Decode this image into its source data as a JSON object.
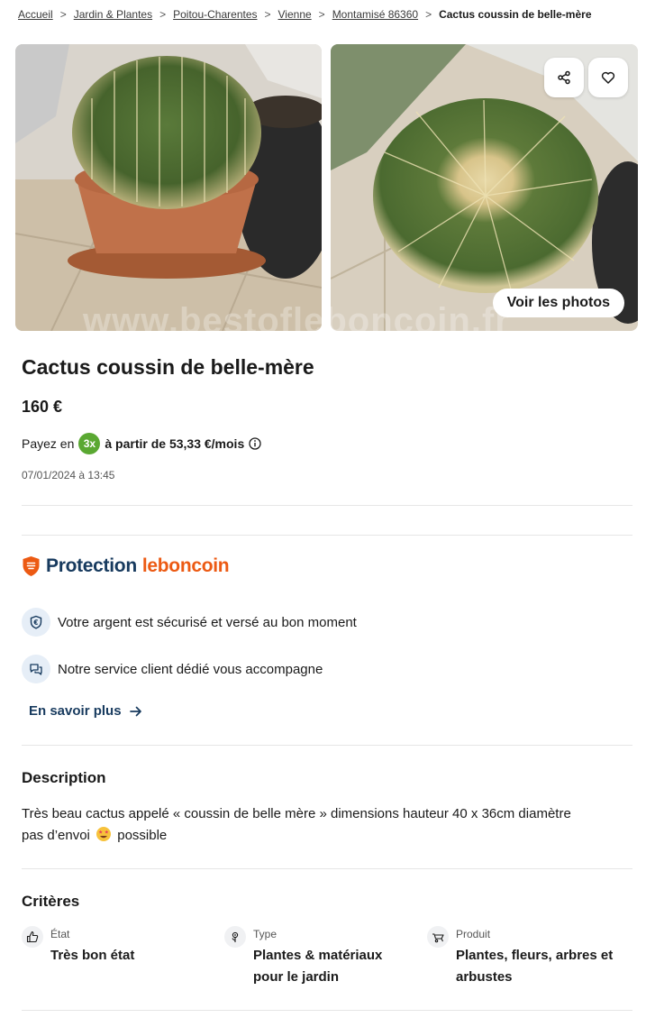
{
  "breadcrumb": {
    "items": [
      "Accueil",
      "Jardin & Plantes",
      "Poitou-Charentes",
      "Vienne",
      "Montamisé 86360"
    ],
    "separator": ">",
    "current": "Cactus coussin de belle-mère"
  },
  "gallery": {
    "see_photos_label": "Voir les photos",
    "watermark": "www.bestofleboncoin.fr",
    "share_icon": "share-icon",
    "favorite_icon": "heart-icon"
  },
  "listing": {
    "title": "Cactus coussin de belle-mère",
    "price": "160 €",
    "pay_prefix": "Payez en",
    "pay_badge": "3x",
    "pay_amount": "à partir de 53,33 €/mois",
    "date": "07/01/2024 à 13:45"
  },
  "protection": {
    "word1": "Protection",
    "word2": "leboncoin",
    "features": [
      {
        "icon": "euro-shield-icon",
        "text": "Votre argent est sécurisé et versé au bon moment"
      },
      {
        "icon": "chat-bubbles-icon",
        "text": "Notre service client dédié vous accompagne"
      }
    ],
    "more_label": "En savoir plus"
  },
  "description": {
    "heading": "Description",
    "line1": "Très beau cactus appelé « coussin de belle mère » dimensions hauteur 40 x 36cm diamètre",
    "line2_before": "pas d’envoi",
    "line2_after": "possible"
  },
  "criteria": {
    "heading": "Critères",
    "items": [
      {
        "icon": "thumbs-up-icon",
        "label": "État",
        "value": "Très bon état"
      },
      {
        "icon": "plant-icon",
        "label": "Type",
        "value": "Plantes & matériaux pour le jardin"
      },
      {
        "icon": "wheelbarrow-icon",
        "label": "Produit",
        "value": "Plantes, fleurs, arbres et arbustes"
      }
    ]
  },
  "colors": {
    "accent": "#ec5a13",
    "navy": "#173a5e",
    "installment_badge": "#5aa832",
    "text": "#1a1a1a"
  }
}
